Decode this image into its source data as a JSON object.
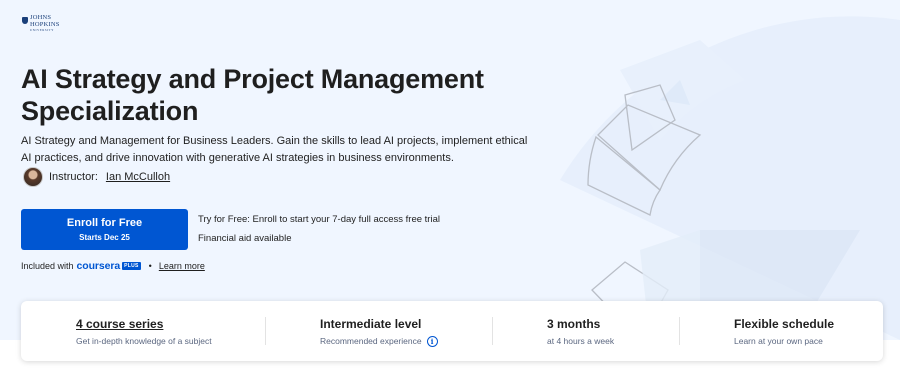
{
  "partner": {
    "logo_line1": "JOHNS",
    "logo_line2": "HOPKINS",
    "logo_line3": "UNIVERSITY"
  },
  "course": {
    "title": "AI Strategy and Project Management Specialization",
    "description": "AI Strategy and Management for Business Leaders. Gain the skills to lead AI projects, implement ethical AI practices, and drive innovation with generative AI strategies in business environments.",
    "instructor_label": "Instructor:",
    "instructor_name": "Ian McCulloh"
  },
  "enroll": {
    "button_label": "Enroll for Free",
    "button_sub": "Starts Dec 25",
    "trial_text": "Try for Free: Enroll to start your 7-day full access free trial",
    "financial_aid": "Financial aid available"
  },
  "included": {
    "prefix": "Included with",
    "brand": "coursera",
    "plus": "PLUS",
    "bullet": "•",
    "learn_more": "Learn more"
  },
  "stats": [
    {
      "title": "4 course series",
      "subtitle": "Get in-depth knowledge of a subject"
    },
    {
      "title": "Intermediate level",
      "subtitle": "Recommended experience"
    },
    {
      "title": "3 months",
      "subtitle": "at 4 hours a week"
    },
    {
      "title": "Flexible schedule",
      "subtitle": "Learn at your own pace"
    }
  ],
  "icons": {
    "info": "info-circle-icon",
    "logo": "shield-icon"
  },
  "colors": {
    "accent": "#0056d2",
    "hero_bg": "#f0f6ff",
    "text": "#1f1f1f",
    "muted": "#5b6780"
  }
}
